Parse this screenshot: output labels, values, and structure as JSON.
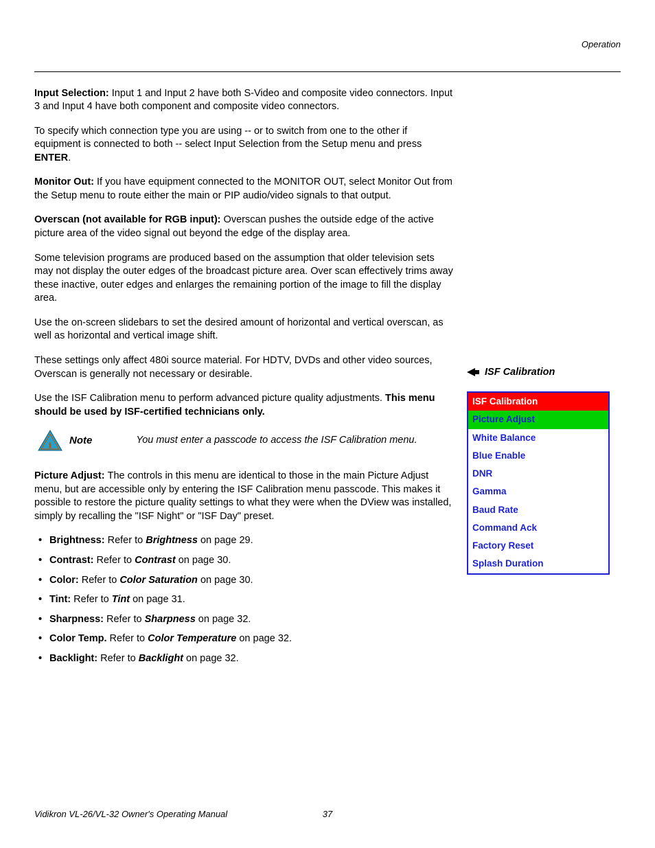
{
  "header": {
    "section": "Operation"
  },
  "main": {
    "p1": {
      "lead": "Input Selection: ",
      "text": "Input 1 and Input 2 have both S-Video and composite video connectors. Input 3 and Input 4 have both component and composite video connectors."
    },
    "p2": {
      "text1": "To specify which connection type you are using -- or to switch from one to the other if equipment is connected to both -- select Input Selection from the Setup menu and press ",
      "enter": "ENTER",
      "text2": "."
    },
    "p3": {
      "lead": "Monitor Out: ",
      "text": "If you have equipment connected to the MONITOR OUT, select Monitor Out from the Setup menu to route either the main or PIP audio/video signals to that output."
    },
    "p4": {
      "lead": "Overscan (not available for RGB input): ",
      "text": "Overscan pushes the outside edge of the active picture area of the video signal out beyond the edge of the display area."
    },
    "p5": "Some television programs are produced based on the assumption that older television sets may not display the outer edges of the broadcast picture area. Over scan effectively trims away these inactive, outer edges and enlarges the remaining portion of the image to fill the display area.",
    "p6": "Use the on-screen slidebars to set the desired amount of horizontal and vertical overscan, as well as horizontal and vertical image shift.",
    "p7": "These settings only affect 480i source material. For HDTV, DVDs and other video sources, Overscan is generally not necessary or desirable.",
    "p8": {
      "text": "Use the ISF Calibration menu to perform advanced picture quality adjustments. ",
      "bold": "This menu should be used by ISF-certified technicians only."
    },
    "note": {
      "label": "Note",
      "text": "You must enter a passcode to access the ISF Calibration menu."
    },
    "p9": {
      "lead": "Picture Adjust: ",
      "text": "The controls in this menu are identical to those in the main Picture Adjust menu, but are accessible only by entering the ISF Calibration menu passcode. This makes it possible to restore the picture quality settings to what they were when the DView was installed, simply by recalling the \"ISF Night\" or \"ISF Day\" preset."
    },
    "bullets": [
      {
        "label": "Brightness:",
        "pre": " Refer to ",
        "ref": "Brightness",
        "post": " on page 29."
      },
      {
        "label": "Contrast:",
        "pre": " Refer to ",
        "ref": "Contrast",
        "post": " on page 30."
      },
      {
        "label": "Color:",
        "pre": " Refer to ",
        "ref": "Color Saturation",
        "post": " on page 30."
      },
      {
        "label": "Tint:",
        "pre": " Refer to ",
        "ref": "Tint",
        "post": " on page 31."
      },
      {
        "label": "Sharpness:",
        "pre": " Refer to ",
        "ref": "Sharpness",
        "post": " on page 32."
      },
      {
        "label": "Color Temp.",
        "pre": " Refer to ",
        "ref": "Color Temperature",
        "post": " on page 32."
      },
      {
        "label": "Backlight:",
        "pre": " Refer to ",
        "ref": "Backlight",
        "post": " on page 32."
      }
    ]
  },
  "side": {
    "heading": "ISF Calibration",
    "menu": {
      "title": "ISF Calibration",
      "highlight": "Picture Adjust",
      "items": [
        "White Balance",
        "Blue Enable",
        "DNR",
        "Gamma",
        "Baud Rate",
        "Command Ack",
        "Factory Reset",
        "Splash Duration"
      ]
    }
  },
  "footer": {
    "title": "Vidikron VL-26/VL-32 Owner's Operating Manual",
    "page": "37"
  }
}
